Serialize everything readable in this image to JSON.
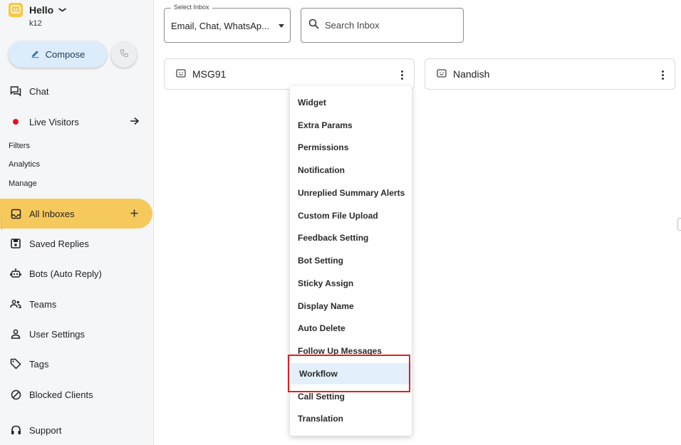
{
  "brand": {
    "logo_icon": "smiley-icon",
    "name": "Hello",
    "subtitle": "k12"
  },
  "compose": {
    "label": "Compose",
    "icon": "pencil-icon"
  },
  "phone_button": {
    "icon": "phone-icon"
  },
  "nav": {
    "chat": "Chat",
    "live_visitors": "Live Visitors",
    "filters": "Filters",
    "analytics": "Analytics",
    "manage": "Manage",
    "all_inboxes": "All Inboxes",
    "saved_replies": "Saved Replies",
    "bots": "Bots (Auto Reply)",
    "teams": "Teams",
    "user_settings": "User Settings",
    "tags": "Tags",
    "blocked_clients": "Blocked Clients",
    "support": "Support"
  },
  "select_inbox": {
    "legend": "Select Inbox",
    "value": "Email, Chat, WhatsAp..."
  },
  "search": {
    "placeholder": "Search Inbox"
  },
  "cards": [
    {
      "name": "MSG91"
    },
    {
      "name": "Nandish"
    }
  ],
  "menu": {
    "items": [
      "Widget",
      "Extra Params",
      "Permissions",
      "Notification",
      "Unreplied Summary Alerts",
      "Custom File Upload",
      "Feedback Setting",
      "Bot Setting",
      "Sticky Assign",
      "Display Name",
      "Auto Delete",
      "Follow Up Messages",
      "Workflow",
      "Call Setting",
      "Translation"
    ],
    "highlighted_index": 12
  },
  "colors": {
    "active_nav": "#f6c95c",
    "compose_bg": "#dcecfb",
    "live_dot": "#e8101e",
    "highlight_box": "#e02020",
    "menu_highlight": "#e3f0fb"
  }
}
